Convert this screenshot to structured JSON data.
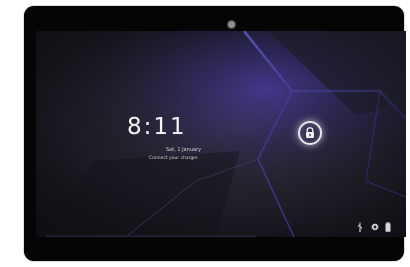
{
  "lockscreen": {
    "time": "8:11",
    "date": "Sat, 1 January",
    "charger_message": "Connect your charger."
  },
  "icons": {
    "lock": "lock-icon",
    "usb": "usb-icon",
    "settings": "gear-icon",
    "battery": "battery-icon"
  },
  "colors": {
    "screen_dark": "#14141b",
    "accent_purple": "#3a2f8c",
    "text_light": "#f4f4f4"
  }
}
